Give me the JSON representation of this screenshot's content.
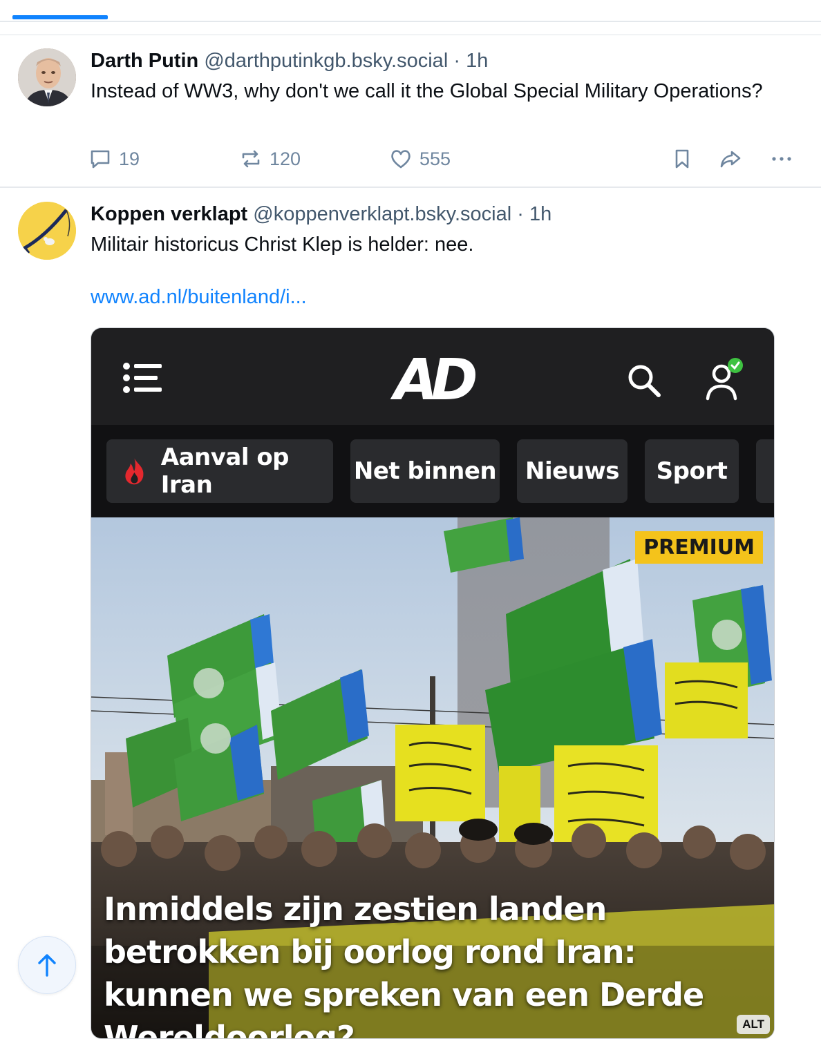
{
  "feed": {
    "posts": [
      {
        "display_name": "Darth Putin",
        "handle": "@darthputinkgb.bsky.social",
        "separator": "·",
        "time": "1h",
        "text": "Instead of WW3, why don't we call it the Global Special Military Operations?",
        "reply_count": "19",
        "repost_count": "120",
        "like_count": "555"
      },
      {
        "display_name": "Koppen verklapt",
        "handle": "@koppenverklapt.bsky.social",
        "separator": "·",
        "time": "1h",
        "text": "Militair historicus Christ Klep is helder: nee.",
        "link_text": "www.ad.nl/buitenland/i...",
        "embed": {
          "logo": "AD",
          "nav_items": [
            "Aanval op Iran",
            "Net binnen",
            "Nieuws",
            "Sport"
          ],
          "badge": "PREMIUM",
          "headline": "Inmiddels zijn zestien landen betrokken bij oorlog rond Iran: kunnen we spreken van een Derde Wereldoorlog?",
          "alt_label": "ALT"
        }
      }
    ]
  },
  "icons": {
    "reply": "reply-icon",
    "repost": "repost-icon",
    "like": "heart-icon",
    "bookmark": "bookmark-icon",
    "share": "share-icon",
    "more": "more-icon",
    "menu": "hamburger-menu-icon",
    "search": "search-icon",
    "account": "account-icon",
    "fire": "fire-icon",
    "scroll_top": "arrow-up-icon"
  },
  "colors": {
    "accent": "#1083fe",
    "muted": "#6f869f",
    "premium": "#f4c31b"
  }
}
